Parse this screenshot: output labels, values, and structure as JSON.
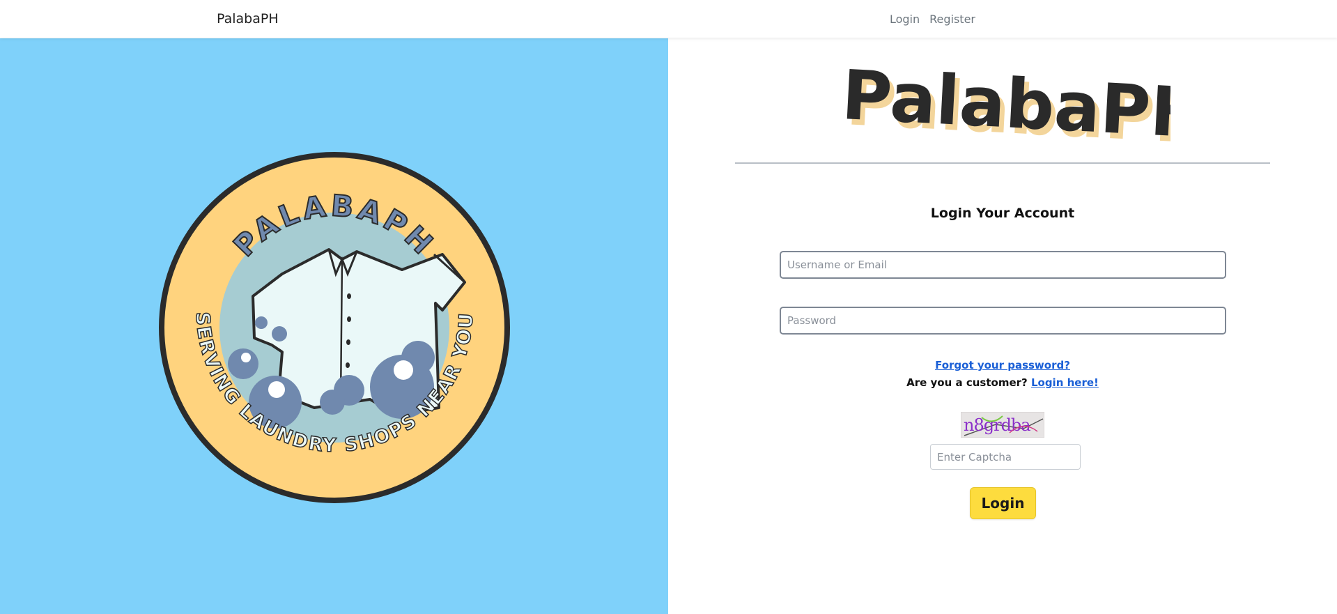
{
  "navbar": {
    "brand": "PalabaPH",
    "links": [
      "Login",
      "Register"
    ]
  },
  "logo": {
    "top_text": "PALABAPH",
    "bottom_text": "SERVING LAUNDRY SHOPS NEAR YOU",
    "colors": {
      "background": "#7fd1fa",
      "badge": "#ffd37e",
      "inner": "#a6ccd2",
      "shirt": "#eaf8f8",
      "bubble": "#7089ae"
    }
  },
  "wordmark": "PalabaPH",
  "form": {
    "title": "Login Your Account",
    "username_placeholder": "Username or Email",
    "password_placeholder": "Password",
    "forgot_link": "Forgot your password?",
    "customer_prompt": "Are you a customer?",
    "customer_link": "Login here!",
    "captcha_text": "n8grdba",
    "captcha_placeholder": "Enter Captcha",
    "submit_label": "Login"
  },
  "colors": {
    "accent_button": "#fddc3e",
    "link": "#1a5fd6"
  }
}
